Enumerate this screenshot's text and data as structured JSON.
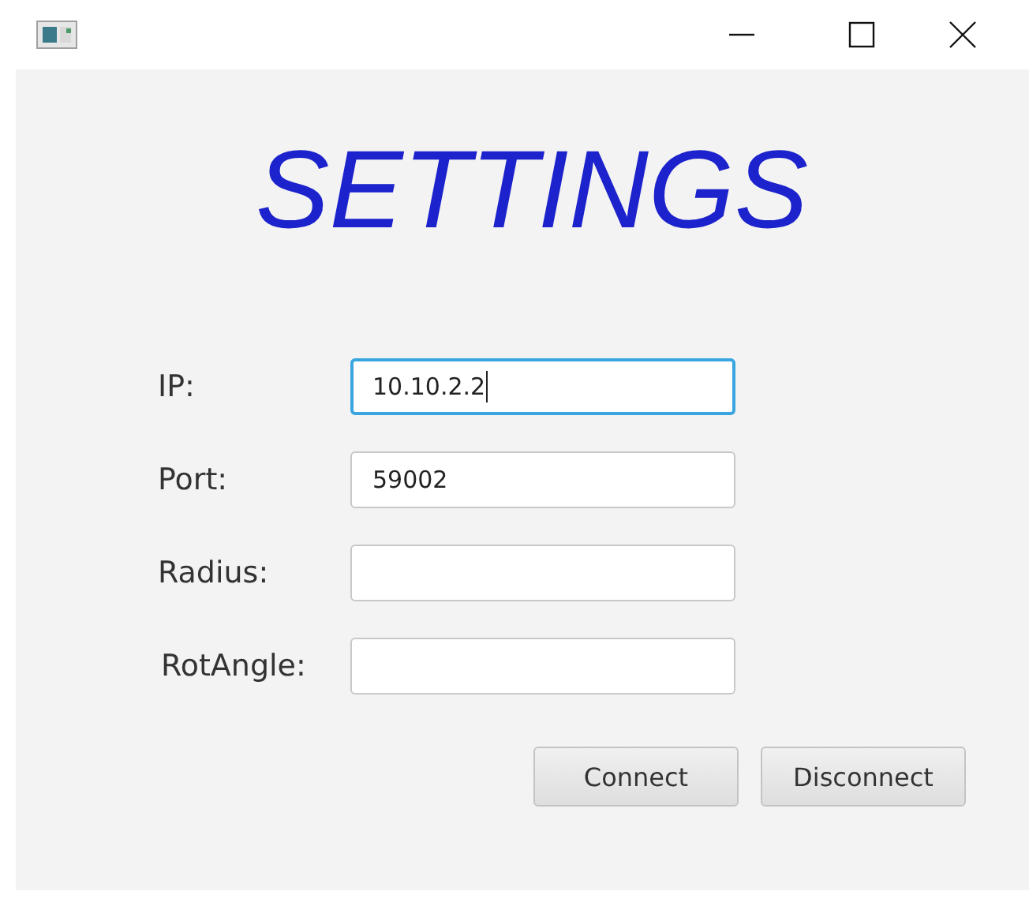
{
  "window": {
    "controls": [
      {
        "kind": "minimize"
      },
      {
        "kind": "maximize"
      },
      {
        "kind": "close"
      }
    ]
  },
  "heading": "SETTINGS",
  "fields": [
    {
      "label": "IP:",
      "value": "10.10.2.2",
      "focused": true
    },
    {
      "label": "Port:",
      "value": "59002",
      "focused": false
    },
    {
      "label": "Radius:",
      "focused": false
    },
    {
      "label": "RotAngle:",
      "focused": false
    }
  ],
  "buttons": [
    "Connect",
    "Disconnect"
  ]
}
